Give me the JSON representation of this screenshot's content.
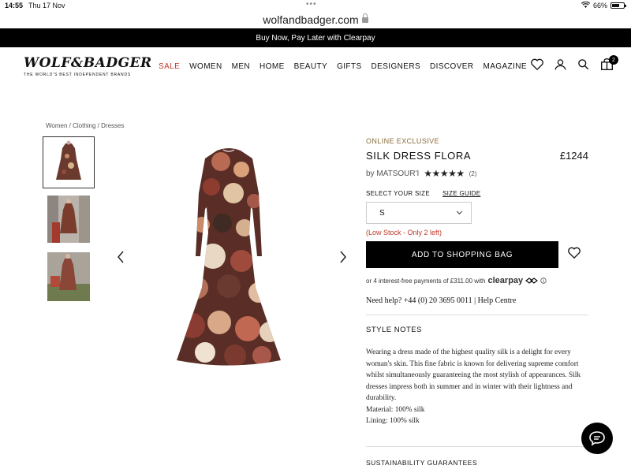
{
  "status_bar": {
    "time": "14:55",
    "date": "Thu 17 Nov",
    "battery": "66%",
    "battery_level": 0.66
  },
  "browser": {
    "url": "wolfandbadger.com"
  },
  "promo": {
    "text": "Buy Now, Pay Later with Clearpay"
  },
  "header": {
    "logo": "WOLF&BADGER",
    "tagline": "THE WORLD'S BEST INDEPENDENT BRANDS",
    "nav": [
      "SALE",
      "WOMEN",
      "MEN",
      "HOME",
      "BEAUTY",
      "GIFTS",
      "DESIGNERS",
      "DISCOVER",
      "MAGAZINE"
    ],
    "bag_count": "2"
  },
  "breadcrumb": [
    "Women",
    "Clothing",
    "Dresses"
  ],
  "product": {
    "badge": "ONLINE EXCLUSIVE",
    "title": "SILK DRESS FLORA",
    "price": "£1244",
    "by_label": "by MATSOUR'I",
    "stars": "★★★★★",
    "rating": 5,
    "rating_count": "(2)",
    "size_label": "SELECT YOUR SIZE",
    "size_guide": "SIZE GUIDE",
    "selected_size": "S",
    "stock": "(Low Stock - Only 2 left)",
    "add_button": "ADD TO SHOPPING BAG",
    "clearpay_text": "or 4 interest-free payments of £311.00 with",
    "clearpay_brand": "clearpay",
    "help": "Need help? +44 (0) 20 3695 0011 | Help Centre",
    "style_notes_title": "STYLE NOTES",
    "style_notes": "Wearing a dress made of the highest quality silk is a delight for every woman's skin. This fine fabric is known for delivering supreme comfort whilst simultaneously guaranteeing the most stylish of appearances. Silk dresses impress both in summer and in winter with their lightness and durability.",
    "material": "Material: 100% silk",
    "lining": "Lining: 100% silk",
    "sustainability_title": "SUSTAINABILITY GUARANTEES"
  },
  "colors": {
    "sale": "#c0392b",
    "stock": "#c0392b",
    "exclusive": "#8a6d3b"
  }
}
